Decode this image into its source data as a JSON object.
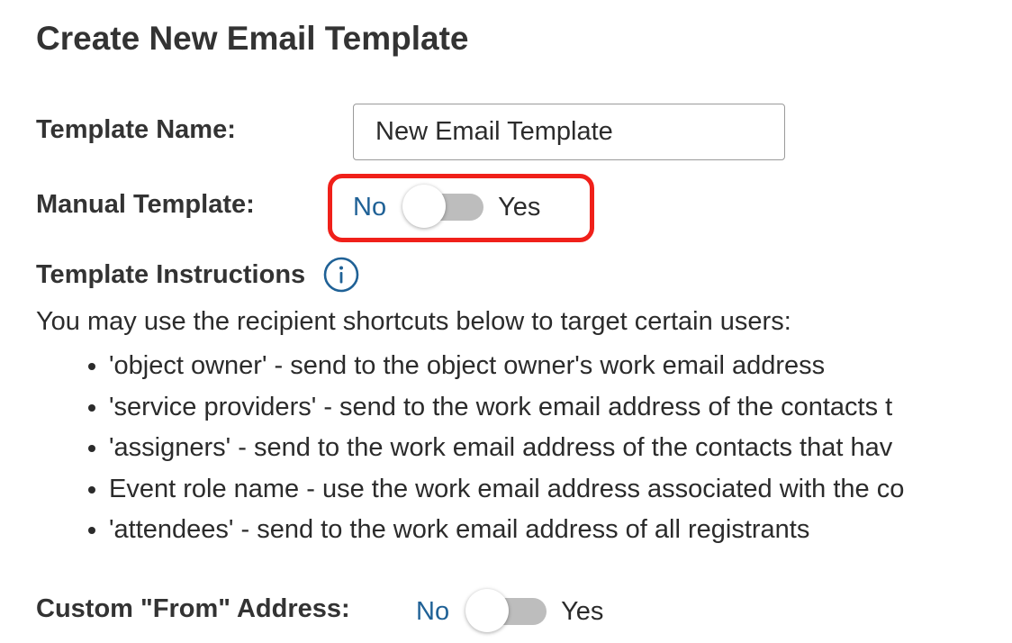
{
  "page": {
    "title": "Create New Email Template"
  },
  "template_name": {
    "label": "Template Name:",
    "value": "New Email Template"
  },
  "manual_template": {
    "label": "Manual Template:",
    "off_label": "No",
    "on_label": "Yes",
    "enabled": false,
    "highlight_color": "#f0201a"
  },
  "instructions": {
    "heading": "Template Instructions",
    "info_icon": "info-circle-icon",
    "intro": "You may use the recipient shortcuts below to target certain users:",
    "items": [
      "'object owner' - send to the object owner's work email address",
      "'service providers' - send to the work email address of the contacts t",
      "'assigners' - send to the work email address of the contacts that hav",
      "Event role name - use the work email address associated with the co",
      "'attendees' - send to the work email address of all registrants"
    ]
  },
  "custom_from": {
    "label": "Custom \"From\" Address:",
    "off_label": "No",
    "on_label": "Yes",
    "enabled": false
  },
  "colors": {
    "accent_blue": "#1f6196",
    "toggle_track_off": "#bdbdbd",
    "highlight_red": "#f0201a"
  }
}
